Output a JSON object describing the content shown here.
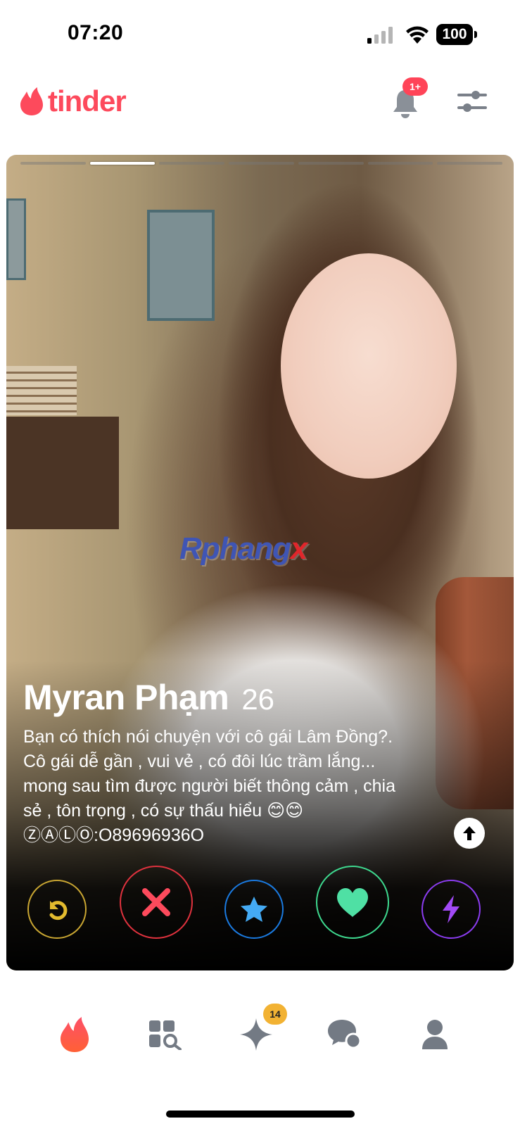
{
  "status_bar": {
    "time": "07:20",
    "battery": "100"
  },
  "header": {
    "logo_text": "tinder",
    "notification_badge": "1+"
  },
  "card": {
    "photo_count": 7,
    "active_photo": 2,
    "watermark": "Rphangx",
    "name": "Myran Phạm",
    "age": "26",
    "bio": "Bạn có thích nói chuyện với cô gái Lâm Đồng?.\nCô gái dễ gần , vui vẻ , có đôi lúc trầm lắng...\nmong sau tìm được người biết thông cảm , chia\nsẻ , tôn trọng , có sự thấu hiểu 😊😊\nⓏⒶⓁⓄ:O89696936O"
  },
  "actions": [
    "rewind",
    "nope",
    "super-like",
    "like",
    "boost"
  ],
  "tab_bar": {
    "spark_badge": "14"
  },
  "colors": {
    "brand": "#fd4a5c",
    "rewind": "#c9a632",
    "nope": "#e0323e",
    "super_like": "#1a7ae0",
    "like": "#3ed98f",
    "boost": "#8b3cf0"
  }
}
